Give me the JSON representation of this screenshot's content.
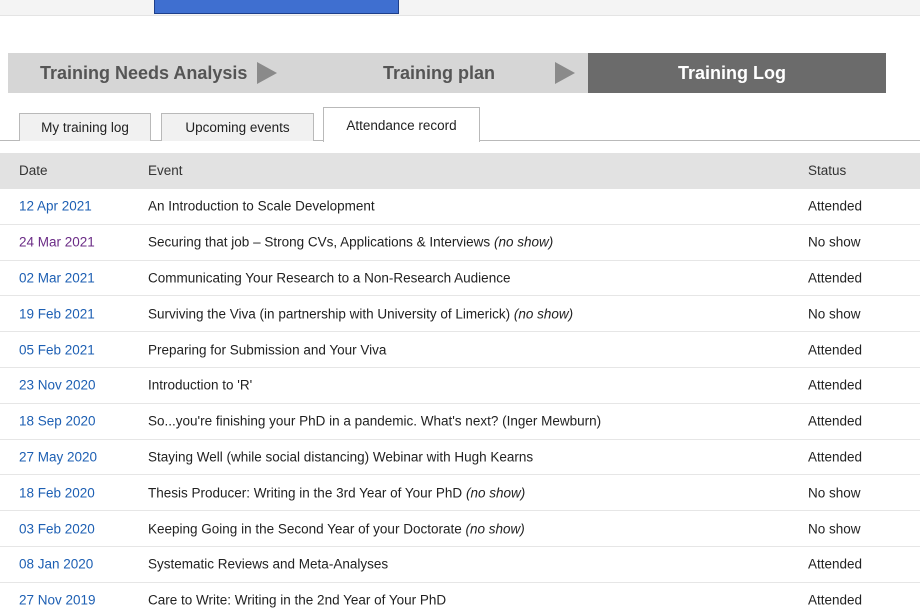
{
  "steps": [
    {
      "label": "Training Needs Analysis"
    },
    {
      "label": "Training plan"
    },
    {
      "label": "Training Log"
    }
  ],
  "tabs": [
    {
      "label": "My training log",
      "active": false
    },
    {
      "label": "Upcoming events",
      "active": false
    },
    {
      "label": "Attendance record",
      "active": true
    }
  ],
  "table": {
    "headers": {
      "date": "Date",
      "event": "Event",
      "status": "Status"
    },
    "rows": [
      {
        "date": "12 Apr 2021",
        "event": "An Introduction to Scale Development",
        "note": "",
        "status": "Attended"
      },
      {
        "date": "24 Mar 2021",
        "event": "Securing that job – Strong CVs, Applications & Interviews",
        "note": "(no show)",
        "status": "No show"
      },
      {
        "date": "02 Mar 2021",
        "event": "Communicating Your Research to a Non-Research Audience",
        "note": "",
        "status": "Attended"
      },
      {
        "date": "19 Feb 2021",
        "event": "Surviving the Viva (in partnership with University of Limerick)",
        "note": "(no show)",
        "status": "No show"
      },
      {
        "date": "05 Feb 2021",
        "event": "Preparing for Submission and Your Viva",
        "note": "",
        "status": "Attended"
      },
      {
        "date": "23 Nov 2020",
        "event": "Introduction to 'R'",
        "note": "",
        "status": "Attended"
      },
      {
        "date": "18 Sep 2020",
        "event": "So...you're finishing your PhD in a pandemic. What's next? (Inger Mewburn)",
        "note": "",
        "status": "Attended"
      },
      {
        "date": "27 May 2020",
        "event": "Staying Well (while social distancing) Webinar with Hugh Kearns",
        "note": "",
        "status": "Attended"
      },
      {
        "date": "18 Feb 2020",
        "event": "Thesis Producer: Writing in the 3rd Year of Your PhD",
        "note": "(no show)",
        "status": "No show"
      },
      {
        "date": "03 Feb 2020",
        "event": "Keeping Going in the Second Year of your Doctorate",
        "note": "(no show)",
        "status": "No show"
      },
      {
        "date": "08 Jan 2020",
        "event": "Systematic Reviews and Meta-Analyses",
        "note": "",
        "status": "Attended"
      },
      {
        "date": "27 Nov 2019",
        "event": "Care to Write: Writing in the 2nd Year of Your PhD",
        "note": "",
        "status": "Attended"
      }
    ]
  },
  "colors": {
    "link": "#1d5fb3",
    "visited_link": "#6b2c86",
    "active_step": "#6b6b6b",
    "inactive_step": "#d6d6d6",
    "top_button": "#3f6fd0"
  }
}
